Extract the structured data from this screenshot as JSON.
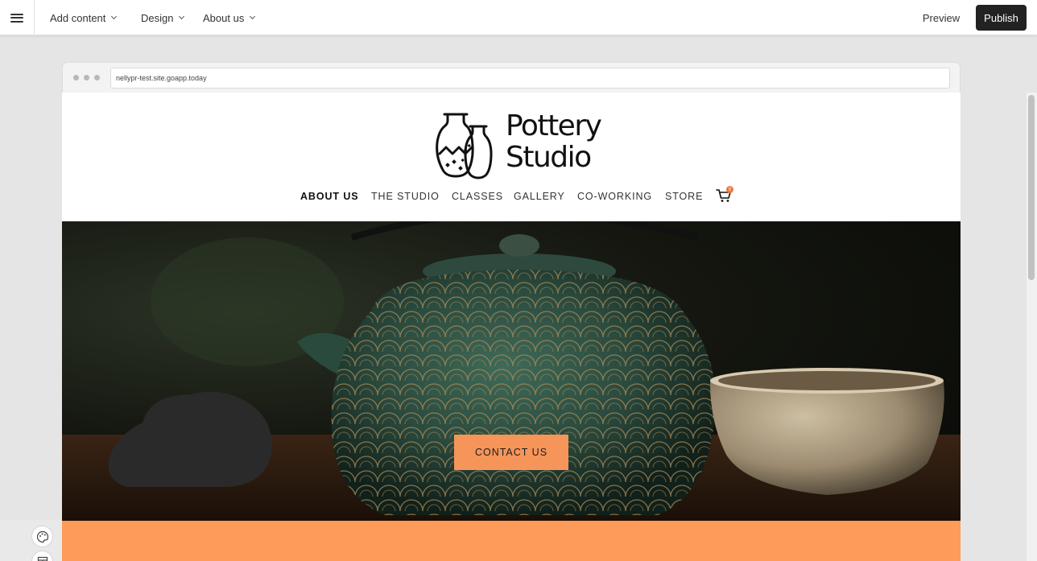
{
  "editor": {
    "menus": [
      {
        "label": "Add content"
      },
      {
        "label": "Design"
      },
      {
        "label": "About us"
      }
    ],
    "preview_label": "Preview",
    "publish_label": "Publish"
  },
  "browser": {
    "url": "nellypr-test.site.goapp.today"
  },
  "site": {
    "logo_line1": "Pottery",
    "logo_line2": "Studio",
    "nav": [
      {
        "label": "ABOUT US",
        "active": true
      },
      {
        "label": "THE STUDIO"
      },
      {
        "label": "CLASSES"
      },
      {
        "label": "GALLERY"
      },
      {
        "label": "CO-WORKING"
      },
      {
        "label": "STORE"
      }
    ],
    "cart_count": "0",
    "hero_button": "CONTACT US",
    "colors": {
      "accent": "#f5955a",
      "band": "#fe9b58",
      "publish_bg": "#222222"
    }
  }
}
